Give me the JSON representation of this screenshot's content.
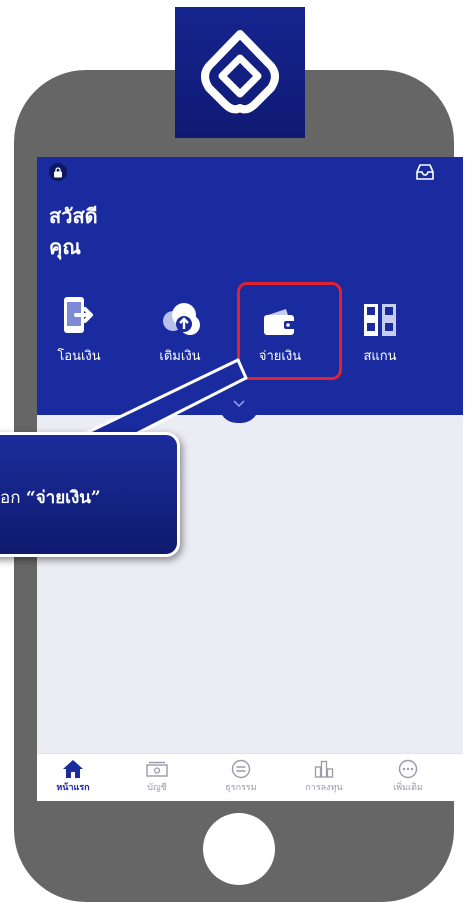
{
  "greeting": {
    "line1": "สวัสดี",
    "line2": "คุณ"
  },
  "quick_actions": [
    {
      "label": "โอนเงิน",
      "icon": "phone-transfer-icon"
    },
    {
      "label": "เติมเงิน",
      "icon": "cloud-upload-icon"
    },
    {
      "label": "จ่ายเงิน",
      "icon": "wallet-icon"
    },
    {
      "label": "สแกน",
      "icon": "qr-scan-icon"
    }
  ],
  "callout": {
    "prefix": "อก ",
    "highlight": "“จ่ายเงิน”"
  },
  "tabbar": {
    "items": [
      {
        "label": "หน้าแรก",
        "icon": "home-icon",
        "active": true
      },
      {
        "label": "บัญชี",
        "icon": "banknote-icon"
      },
      {
        "label": "ธุรกรรม",
        "icon": "transfer-circle-icon"
      },
      {
        "label": "การลงทุน",
        "icon": "chart-icon"
      },
      {
        "label": "เพิ่มเติม",
        "icon": "more-icon"
      }
    ]
  },
  "colors": {
    "brand_blue": "#1a2a9f",
    "highlight_red": "#e1232d",
    "phone_gray": "#666666",
    "screen_bg": "#ececf5"
  }
}
